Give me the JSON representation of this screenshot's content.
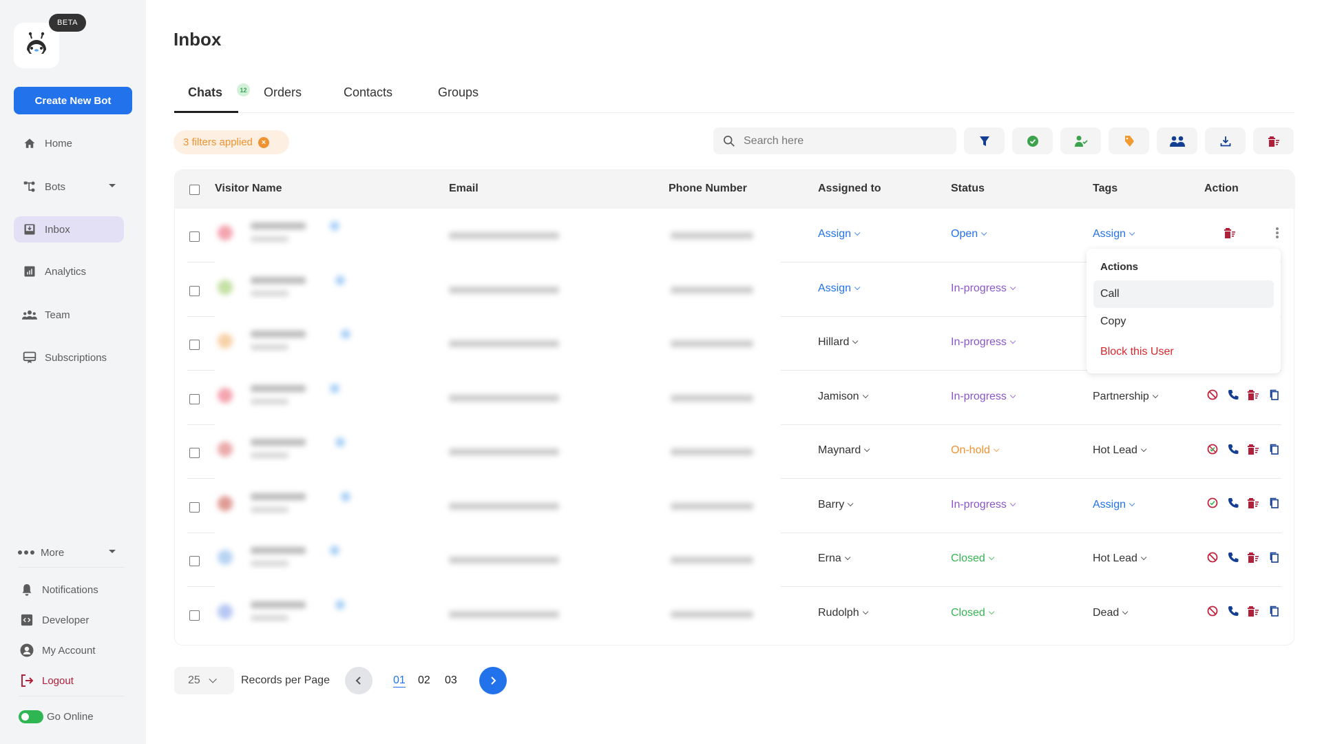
{
  "sidebar": {
    "beta_badge": "BETA",
    "create_button": "Create New Bot",
    "items": [
      {
        "label": "Home",
        "icon": "home-icon"
      },
      {
        "label": "Bots",
        "icon": "bots-icon"
      },
      {
        "label": "Inbox",
        "icon": "inbox-icon",
        "active": true
      },
      {
        "label": "Analytics",
        "icon": "analytics-icon"
      },
      {
        "label": "Team",
        "icon": "team-icon"
      },
      {
        "label": "Subscriptions",
        "icon": "subscriptions-icon"
      }
    ],
    "more_label": "More",
    "bottom_items": [
      {
        "label": "Notifications",
        "icon": "bell-icon"
      },
      {
        "label": "Developer",
        "icon": "developer-icon"
      },
      {
        "label": "My Account",
        "icon": "account-icon"
      },
      {
        "label": "Logout",
        "icon": "logout-icon"
      }
    ],
    "go_online_label": "Go Online",
    "go_online_on": true
  },
  "header": {
    "title": "Inbox",
    "tabs": [
      {
        "label": "Chats",
        "badge": "12",
        "active": true
      },
      {
        "label": "Orders"
      },
      {
        "label": "Contacts"
      },
      {
        "label": "Groups"
      }
    ]
  },
  "toolbar": {
    "filters_chip": "3 filters applied",
    "search_placeholder": "Search here",
    "buttons": [
      "filter-icon",
      "resolve-icon",
      "assign-user-icon",
      "tag-icon",
      "group-icon",
      "download-icon",
      "delete-icon"
    ]
  },
  "table": {
    "columns": [
      "Visitor Name",
      "Email",
      "Phone Number",
      "Assigned to",
      "Status",
      "Tags",
      "Action"
    ],
    "rows": [
      {
        "assigned": "Assign",
        "assigned_color": "blue",
        "status": "Open",
        "status_color": "blue",
        "tag": "Assign",
        "tag_color": "blue",
        "actions": "menu-open"
      },
      {
        "assigned": "Assign",
        "assigned_color": "blue",
        "status": "In-progress",
        "status_color": "purple",
        "tag": "",
        "tag_color": "dark"
      },
      {
        "assigned": "Hillard",
        "assigned_color": "dark",
        "status": "In-progress",
        "status_color": "purple",
        "tag": "",
        "tag_color": "dark"
      },
      {
        "assigned": "Jamison",
        "assigned_color": "dark",
        "status": "In-progress",
        "status_color": "purple",
        "tag": "Partnership",
        "tag_color": "dark",
        "block_state": "block"
      },
      {
        "assigned": "Maynard",
        "assigned_color": "dark",
        "status": "On-hold",
        "status_color": "orange",
        "tag": "Hot Lead",
        "tag_color": "dark",
        "block_state": "unblock-partial"
      },
      {
        "assigned": "Barry",
        "assigned_color": "dark",
        "status": "In-progress",
        "status_color": "purple",
        "tag": "Assign",
        "tag_color": "blue",
        "block_state": "unblock"
      },
      {
        "assigned": "Erna",
        "assigned_color": "dark",
        "status": "Closed",
        "status_color": "green",
        "tag": "Hot Lead",
        "tag_color": "dark",
        "block_state": "block"
      },
      {
        "assigned": "Rudolph",
        "assigned_color": "dark",
        "status": "Closed",
        "status_color": "green",
        "tag": "Dead",
        "tag_color": "dark",
        "block_state": "block"
      }
    ]
  },
  "action_menu": {
    "title": "Actions",
    "items": [
      "Call",
      "Copy",
      "Block this User"
    ]
  },
  "pagination": {
    "per_page": "25",
    "per_page_label": "Records per Page",
    "pages": [
      "01",
      "02",
      "03"
    ],
    "current": "01"
  },
  "colors": {
    "accent": "#2272ec",
    "purple": "#8a55c9",
    "orange": "#f0922f",
    "green": "#35b453",
    "danger": "#d9262c",
    "delete": "#b0203b"
  }
}
